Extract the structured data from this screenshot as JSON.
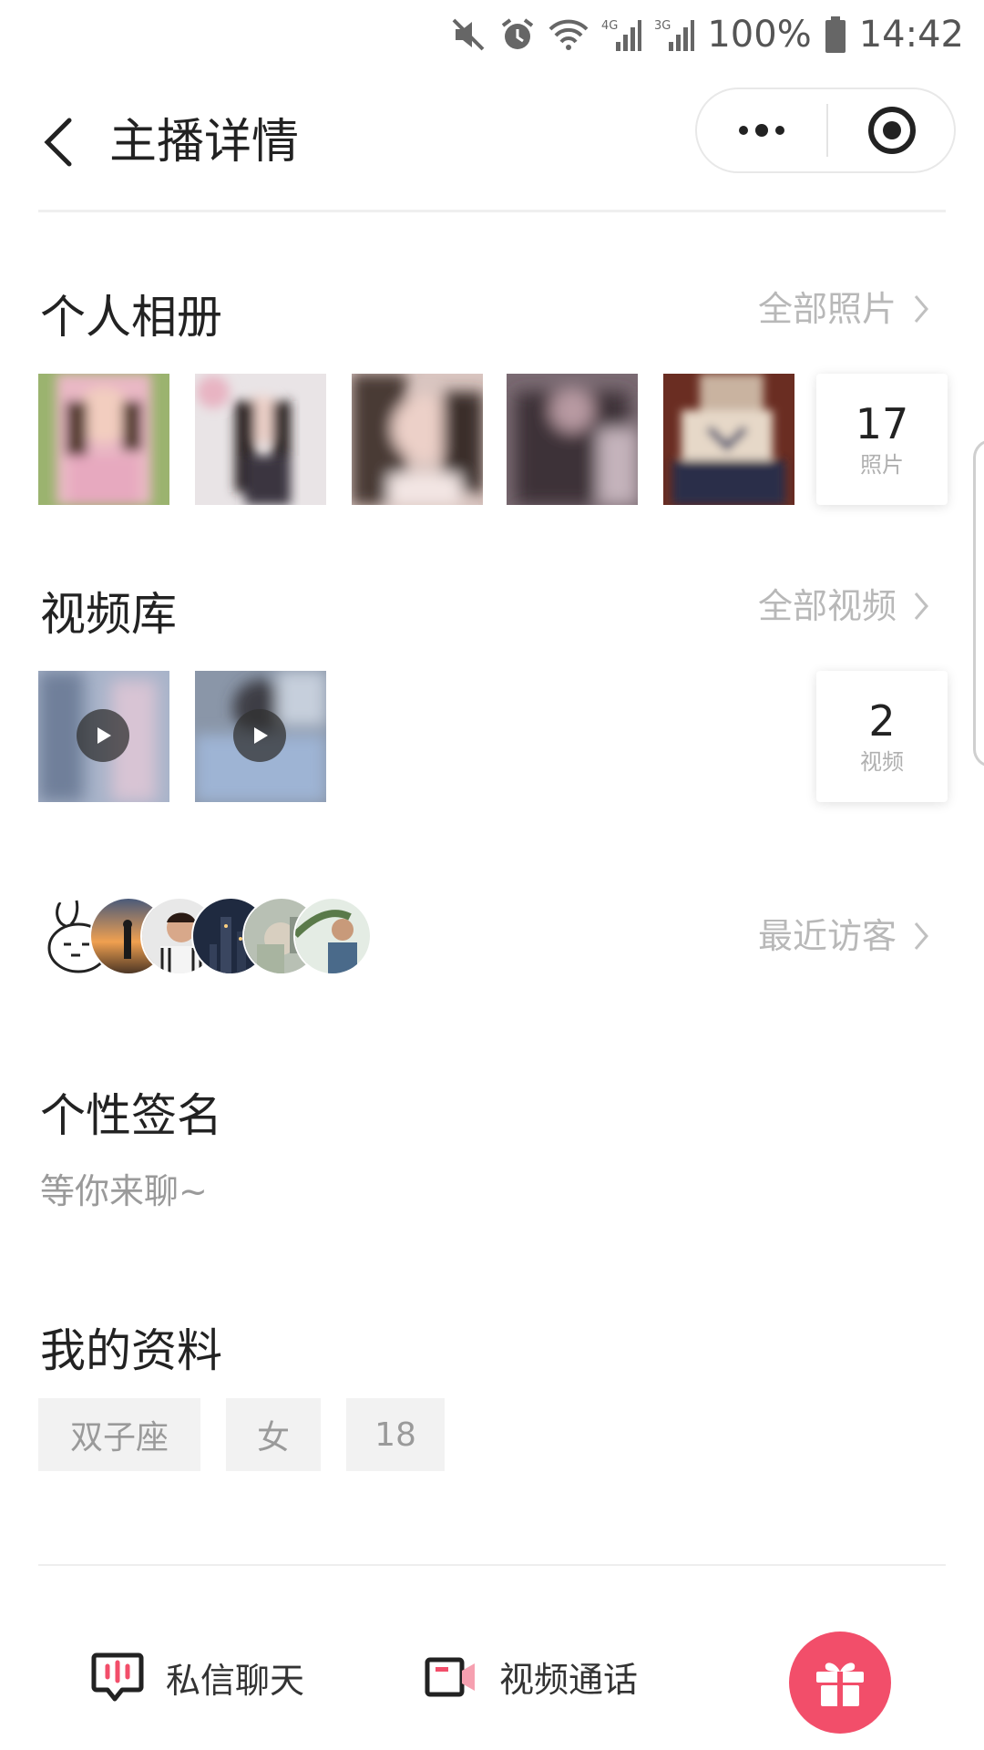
{
  "status_bar": {
    "battery": "100%",
    "time": "14:42"
  },
  "nav": {
    "title": "主播详情",
    "more_icon": "more-dots-icon",
    "close_icon": "target-close-icon"
  },
  "album": {
    "title": "个人相册",
    "link": "全部照片",
    "count": "17",
    "count_label": "照片",
    "photo_colors": [
      "#e9b8c4",
      "#d9d2d6",
      "#c9b0ae",
      "#5a4a50",
      "#7a4d3e"
    ]
  },
  "videos": {
    "title": "视频库",
    "link": "全部视频",
    "count": "2",
    "count_label": "视频",
    "video_colors": [
      "#a7b3c9",
      "#8a96a8"
    ]
  },
  "visitors": {
    "link": "最近访客"
  },
  "signature": {
    "title": "个性签名",
    "text": "等你来聊~"
  },
  "profile": {
    "title": "我的资料",
    "tags": [
      "双子座",
      "女",
      "18"
    ]
  },
  "bottom": {
    "chat_label": "私信聊天",
    "video_call_label": "视频通话",
    "accent": "#f24e6a"
  }
}
